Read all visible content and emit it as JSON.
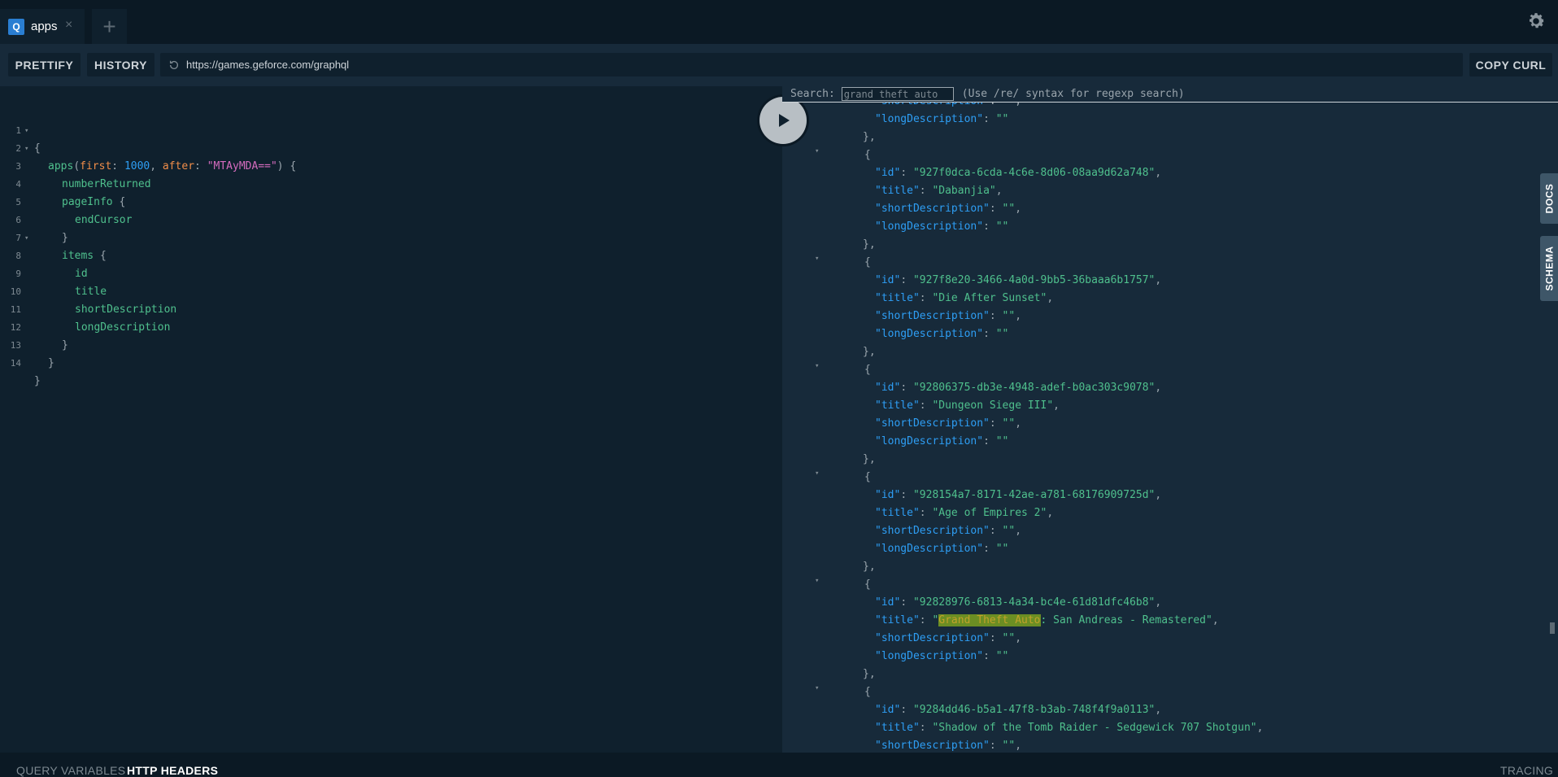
{
  "tabs": [
    {
      "badge": "Q",
      "label": "apps",
      "close": "×"
    }
  ],
  "new_tab": "+",
  "toolbar": {
    "prettify": "PRETTIFY",
    "history": "HISTORY",
    "url": "https://games.geforce.com/graphql",
    "copy_curl": "COPY CURL"
  },
  "editor": {
    "line_numbers": [
      "1",
      "2",
      "3",
      "4",
      "5",
      "6",
      "7",
      "8",
      "9",
      "10",
      "11",
      "12",
      "13",
      "14"
    ],
    "query": {
      "open": "{",
      "field": "apps",
      "paren_open": "(",
      "arg1": "first",
      "colon": ": ",
      "arg1_value": "1000",
      "comma": ", ",
      "arg2": "after",
      "arg2_value": "\"MTAyMDA==\"",
      "paren_close": ") {",
      "numberReturned": "numberReturned",
      "pageInfo": "pageInfo",
      "brace_open": " {",
      "endCursor": "endCursor",
      "brace_close": "}",
      "items": "items",
      "id": "id",
      "title": "title",
      "shortDescription": "shortDescription",
      "longDescription": "longDescription",
      "close": "}"
    }
  },
  "search": {
    "label": "Search:",
    "value": "grand theft auto",
    "hint": "(Use /re/ syntax for regexp search)"
  },
  "result": {
    "top_partial": {
      "short_key": "\"shortDescription\"",
      "long_key": "\"longDescription\"",
      "empty": "\"\""
    },
    "items": [
      {
        "id": "\"927f0dca-6cda-4c6e-8d06-08aa9d62a748\"",
        "title": "\"Dabanjia\""
      },
      {
        "id": "\"927f8e20-3466-4a0d-9bb5-36baaa6b1757\"",
        "title": "\"Die After Sunset\""
      },
      {
        "id": "\"92806375-db3e-4948-adef-b0ac303c9078\"",
        "title": "\"Dungeon Siege III\""
      },
      {
        "id": "\"928154a7-8171-42ae-a781-68176909725d\"",
        "title": "\"Age of Empires 2\""
      },
      {
        "id": "\"92828976-6813-4a34-bc4e-61d81dfc46b8\"",
        "title_hl": "Grand Theft Auto",
        "title_rest": ": San Andreas - Remastered\""
      },
      {
        "id": "\"9284dd46-b5a1-47f8-b3ab-748f4f9a0113\"",
        "title": "\"Shadow of the Tomb Raider - Sedgewick 707 Shotgun\""
      }
    ],
    "keys": {
      "id": "\"id\"",
      "title": "\"title\"",
      "short": "\"shortDescription\"",
      "long": "\"longDescription\""
    },
    "punct": {
      "open": "{",
      "close": "},",
      "colon": ": ",
      "comma": ",",
      "empty": "\"\"",
      "quote": "\""
    }
  },
  "side_tabs": {
    "docs": "DOCS",
    "schema": "SCHEMA"
  },
  "footer": {
    "query_variables": "QUERY VARIABLES",
    "http_headers": "HTTP HEADERS",
    "tracing": "TRACING"
  },
  "colors": {
    "background": "#0f202d",
    "panel": "#172a3a",
    "accent": "#2a7ed2",
    "highlight": "#6b8e23"
  },
  "icons": [
    "close-icon",
    "plus-icon",
    "gear-icon",
    "reset-icon",
    "play-icon",
    "fold-arrow-icon"
  ]
}
